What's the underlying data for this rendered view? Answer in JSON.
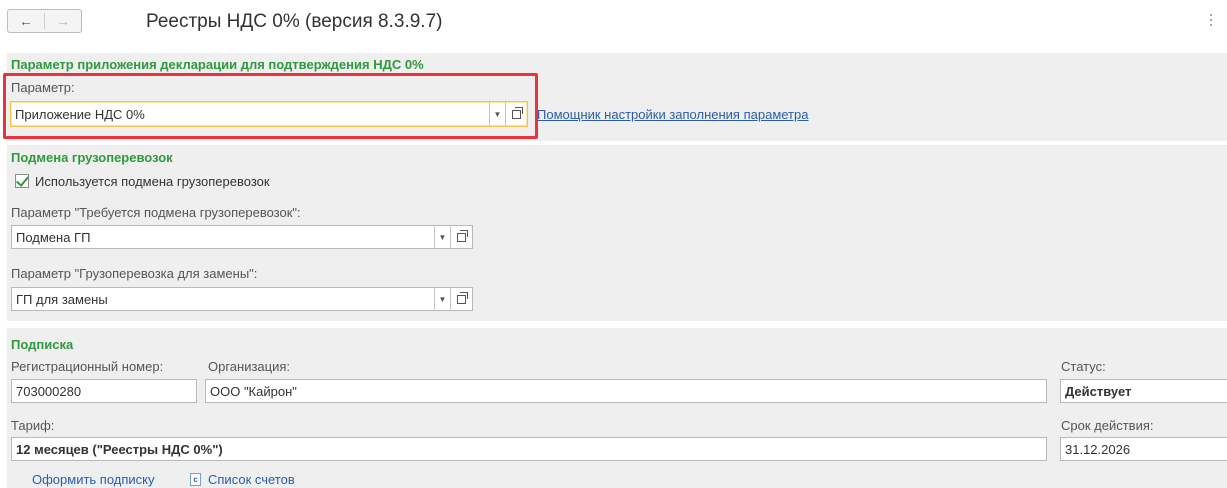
{
  "header": {
    "back_icon": "←",
    "forward_icon": "→",
    "title": "Реестры НДС 0% (версия 8.3.9.7)",
    "more_icon": "more-vertical-icon"
  },
  "declaration": {
    "title": "Параметр приложения декларации для подтверждения НДС 0%",
    "param_label": "Параметр:",
    "param_value": "Приложение НДС 0%",
    "helper_link": "Помощник настройки заполнения параметра"
  },
  "freight": {
    "title": "Подмена грузоперевозок",
    "checkbox_label": "Используется подмена грузоперевозок",
    "checkbox_checked": true,
    "param1_label": "Параметр \"Требуется подмена грузоперевозок\":",
    "param1_value": "Подмена ГП",
    "param2_label": "Параметр \"Грузоперевозка для замены\":",
    "param2_value": "ГП для замены"
  },
  "subscription": {
    "title": "Подписка",
    "reg_label": "Регистрационный номер:",
    "reg_value": "703000280",
    "org_label": "Организация:",
    "org_value": "ООО \"Кайрон\"",
    "status_label": "Статус:",
    "status_value": "Действует",
    "tariff_label": "Тариф:",
    "tariff_value": "12 месяцев (\"Реестры НДС 0%\")",
    "validity_label": "Срок действия:",
    "validity_value": "31.12.2026",
    "subscribe_link": "Оформить подписку",
    "invoices_link": "Список счетов"
  },
  "colors": {
    "accent_green": "#2f9a3e",
    "link_blue": "#2a5db0",
    "highlight_red": "#e8343c",
    "focus_yellow": "#f0c44a"
  }
}
